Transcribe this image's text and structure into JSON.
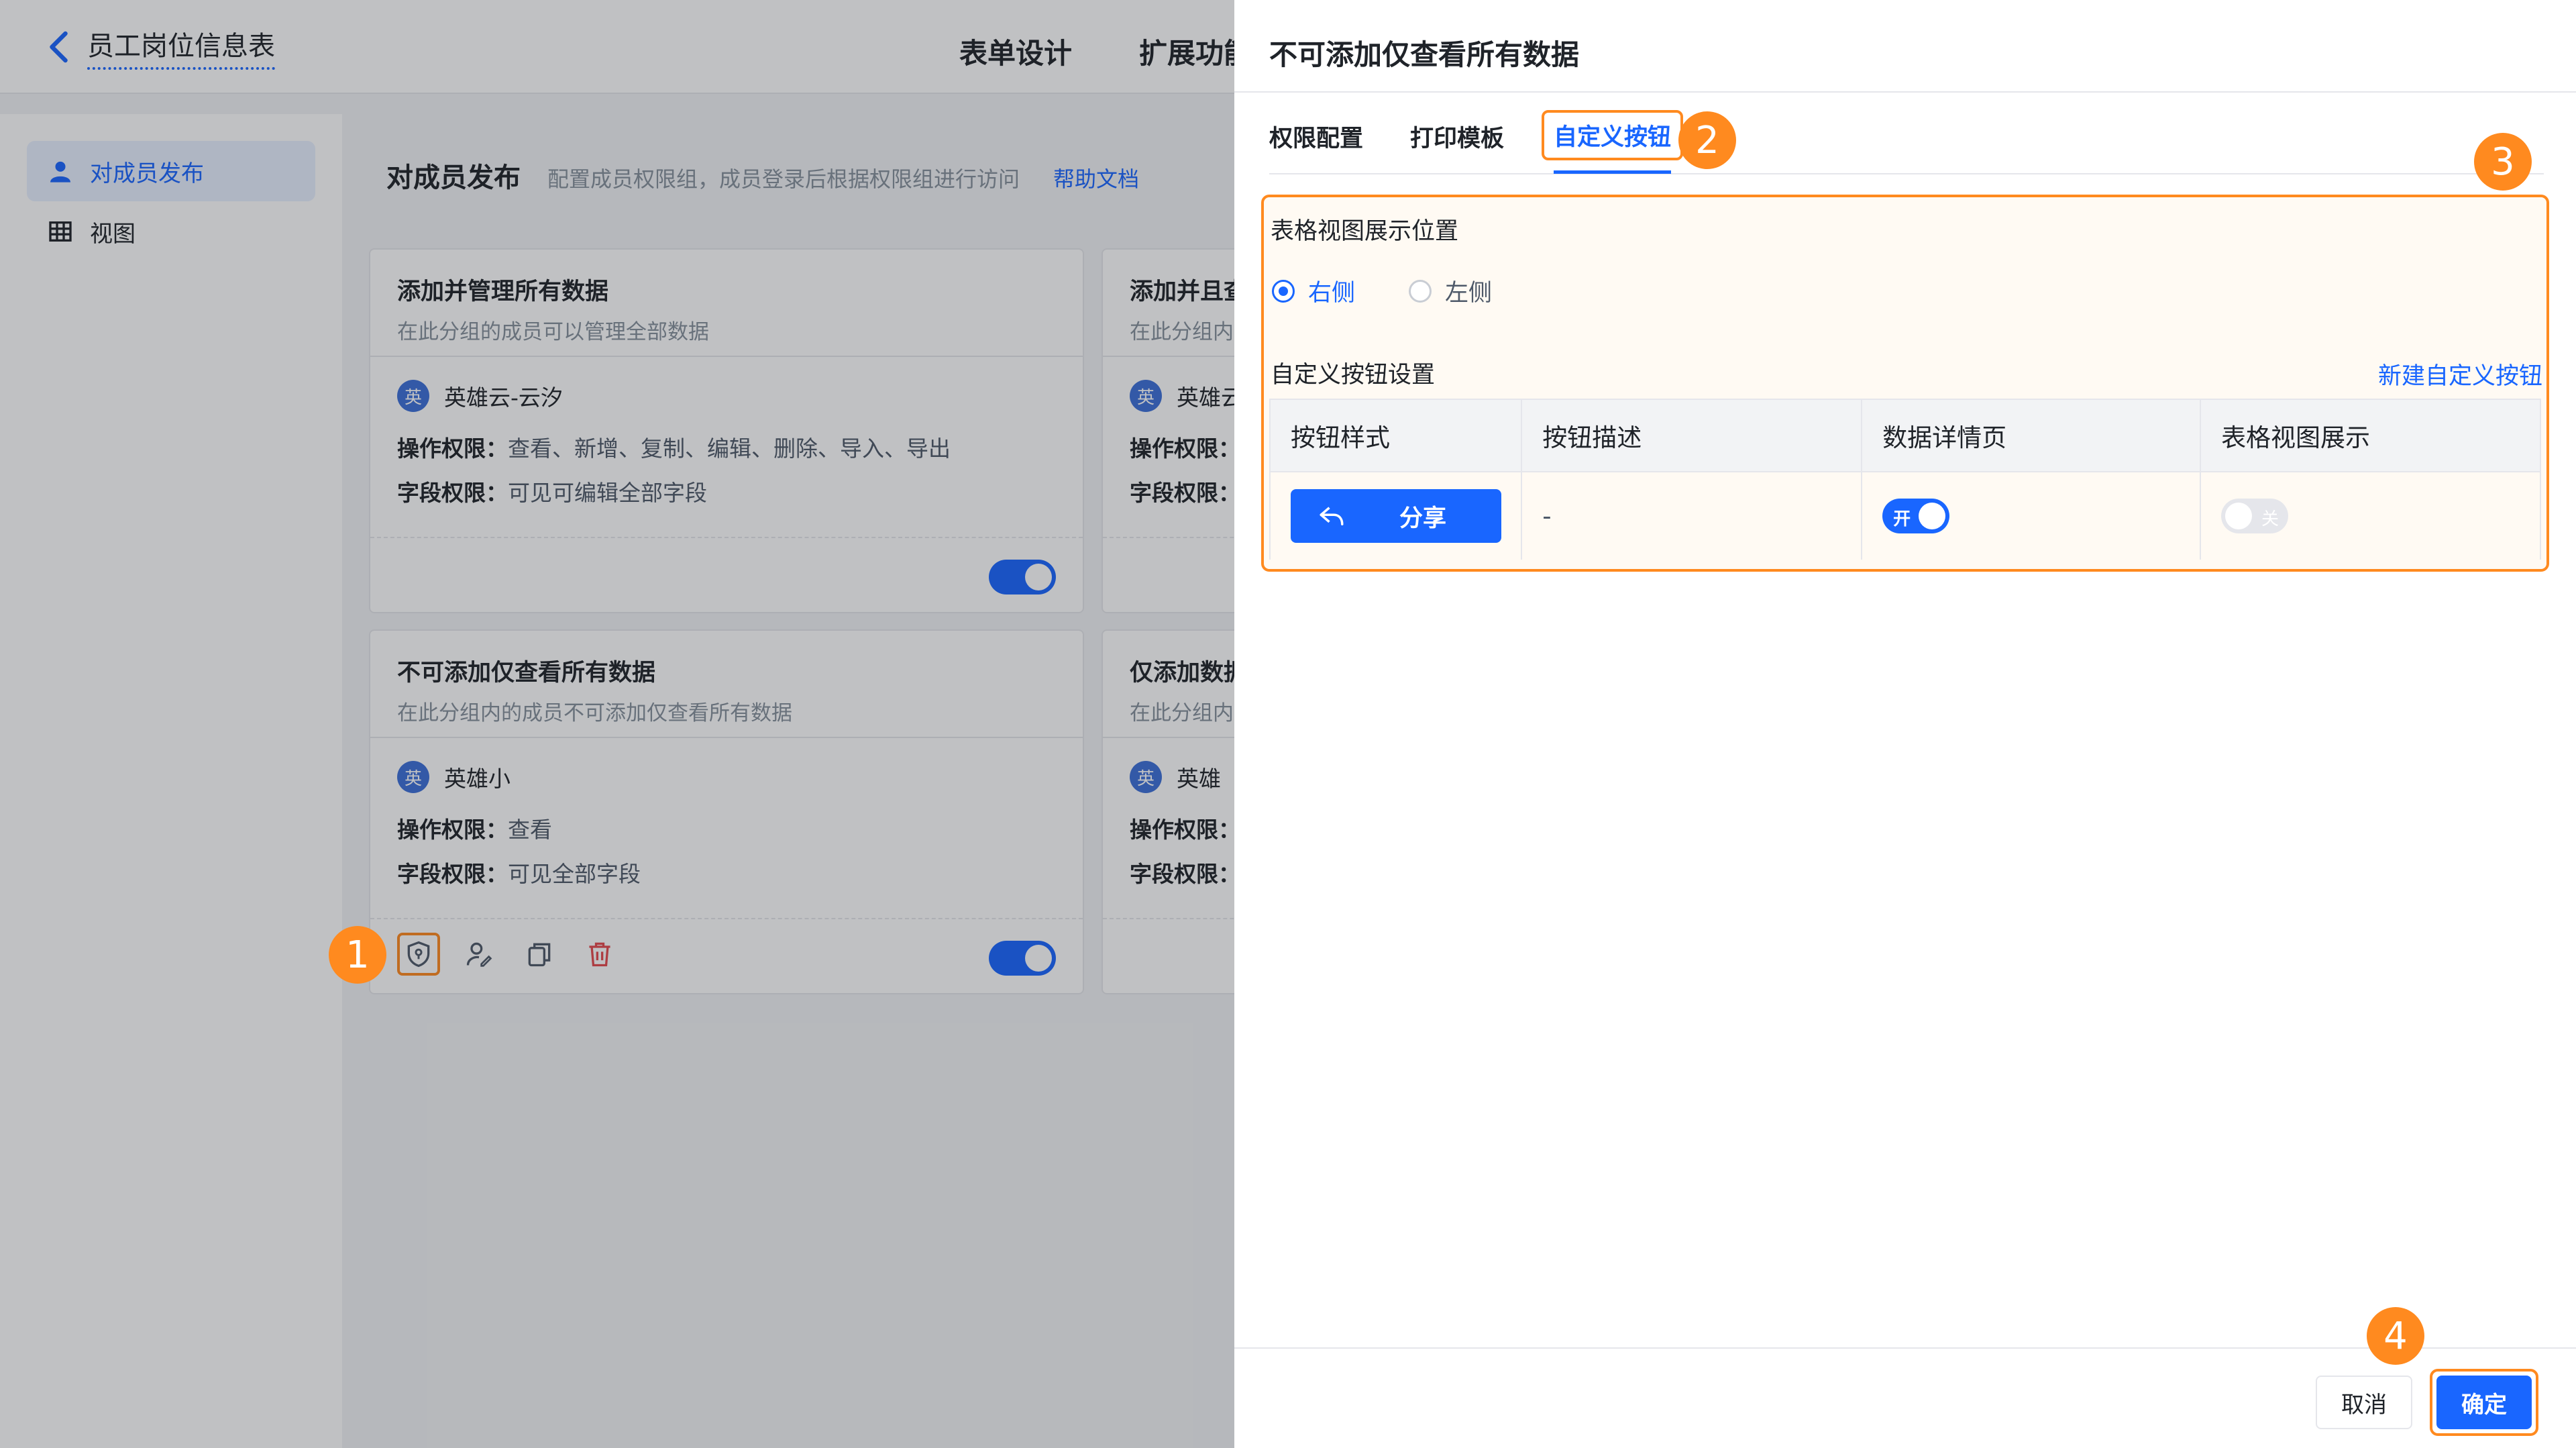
{
  "app": {
    "title": "员工岗位信息表",
    "top_tabs": [
      "表单设计",
      "扩展功能"
    ]
  },
  "sidebar": {
    "items": [
      {
        "label": "对成员发布",
        "icon": "person-icon",
        "active": true
      },
      {
        "label": "视图",
        "icon": "table-icon",
        "active": false
      }
    ]
  },
  "publish": {
    "title": "对成员发布",
    "desc": "配置成员权限组，成员登录后根据权限组进行访问",
    "help": "帮助文档"
  },
  "cards": [
    {
      "title": "添加并管理所有数据",
      "sub": "在此分组的成员可以管理全部数据",
      "member": "英雄云-云汐",
      "op_label": "操作权限：",
      "op_value": "查看、新增、复制、编辑、删除、导入、导出",
      "field_label": "字段权限：",
      "field_value": "可见可编辑全部字段"
    },
    {
      "title": "添加并且查",
      "sub": "在此分组内",
      "member": "英雄云",
      "op_label": "操作权限：",
      "op_value": "",
      "field_label": "字段权限：",
      "field_value": ""
    },
    {
      "title": "不可添加仅查看所有数据",
      "sub": "在此分组内的成员不可添加仅查看所有数据",
      "member": "英雄小",
      "op_label": "操作权限：",
      "op_value": "查看",
      "field_label": "字段权限：",
      "field_value": "可见全部字段"
    },
    {
      "title": "仅添加数据",
      "sub": "在此分组内",
      "member": "英雄",
      "op_label": "操作权限：",
      "op_value": "",
      "field_label": "字段权限：",
      "field_value": ""
    }
  ],
  "avatar_char": "英",
  "drawer": {
    "title": "不可添加仅查看所有数据",
    "tabs": [
      "权限配置",
      "打印模板",
      "自定义按钮"
    ],
    "position_label": "表格视图展示位置",
    "radio_right": "右侧",
    "radio_left": "左侧",
    "custom_label": "自定义按钮设置",
    "new_link": "新建自定义按钮",
    "table": {
      "headers": [
        "按钮样式",
        "按钮描述",
        "数据详情页",
        "表格视图展示"
      ],
      "row": {
        "button_label": "分享",
        "desc": "-",
        "detail_switch": "开",
        "grid_switch": "关"
      }
    },
    "cancel": "取消",
    "confirm": "确定"
  },
  "badges": [
    "1",
    "2",
    "3",
    "4"
  ],
  "colors": {
    "accent": "#1966ff",
    "highlight": "#ff8a1f"
  }
}
